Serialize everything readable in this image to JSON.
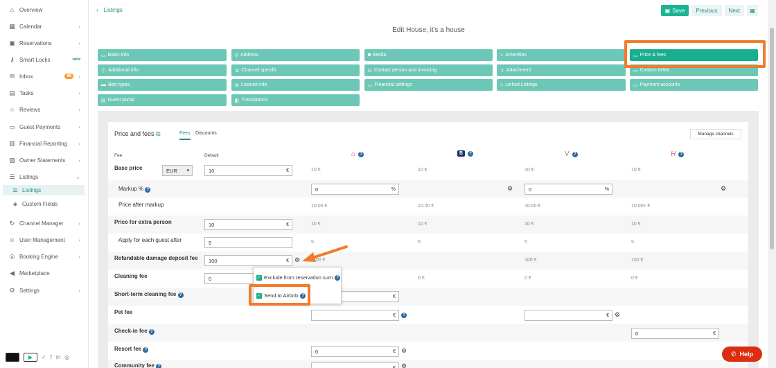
{
  "sidebar": {
    "items": [
      {
        "label": "Overview",
        "icon": "home-icon"
      },
      {
        "label": "Calendar",
        "icon": "calendar-icon"
      },
      {
        "label": "Reservations",
        "icon": "suitcase-icon"
      },
      {
        "label": "Smart Locks",
        "icon": "key-icon",
        "badge": "new"
      },
      {
        "label": "Inbox",
        "icon": "inbox-icon",
        "badge": "96"
      },
      {
        "label": "Tasks",
        "icon": "briefcase-icon"
      },
      {
        "label": "Reviews",
        "icon": "star-icon"
      },
      {
        "label": "Guest Payments",
        "icon": "card-icon"
      },
      {
        "label": "Financial Reporting",
        "icon": "report-icon"
      },
      {
        "label": "Owner Statements",
        "icon": "statement-icon"
      },
      {
        "label": "Listings",
        "icon": "list-icon"
      },
      {
        "label": "Channel Manager",
        "icon": "refresh-icon"
      },
      {
        "label": "User Management",
        "icon": "user-icon"
      },
      {
        "label": "Booking Engine",
        "icon": "globe-icon"
      },
      {
        "label": "Marketplace",
        "icon": "megaphone-icon"
      },
      {
        "label": "Settings",
        "icon": "gear-icon"
      }
    ],
    "sub": [
      {
        "label": "Listings"
      },
      {
        "label": "Custom Fields"
      }
    ]
  },
  "header": {
    "back": "Listings",
    "save": "Save",
    "previous": "Previous",
    "next": "Next",
    "title": "Edit House, it's a house"
  },
  "tabs": [
    "Basic info",
    "Address",
    "Media",
    "Amenities",
    "Price & fees",
    "Additional info",
    "Channel specific",
    "Contact person and invoicing",
    "Attachment",
    "Custom fields",
    "Bed types",
    "License info",
    "Financial settings",
    "Linked Listings",
    "Payment accounts",
    "Guest portal",
    "Translations"
  ],
  "card": {
    "title": "Price and fees",
    "subtabs": [
      "Fees",
      "Discounts"
    ],
    "manage": "Manage channels",
    "col_fee": "Fee",
    "col_default": "Default",
    "currency": "EUR"
  },
  "rows": {
    "base_price": {
      "label": "Base price",
      "default": "10",
      "v1": "10 €",
      "v2": "10 €",
      "v3": "10 €",
      "v4": "10 €"
    },
    "markup": {
      "label": "Markup %",
      "v1": "0",
      "v3": "0"
    },
    "after_markup": {
      "label": "Price after markup",
      "v1": "10.00 €",
      "v2": "10.00 €",
      "v3": "10.00 €",
      "v4": "10.00+ €"
    },
    "extra_person": {
      "label": "Price for extra person",
      "default": "10",
      "v1": "10 €",
      "v2": "10 €",
      "v3": "10 €",
      "v4": "10 €"
    },
    "each_guest": {
      "label": "Apply for each guest after",
      "default": "5",
      "v1": "5",
      "v2": "5",
      "v3": "5",
      "v4": "5"
    },
    "deposit": {
      "label": "Refundable damage deposit fee",
      "default": "100",
      "v1": "100 €",
      "v3": "100 €",
      "v4": "100 €"
    },
    "cleaning": {
      "label": "Cleaning fee",
      "default": "0",
      "v2": "0 €",
      "v3": "0 €",
      "v4": "0 €"
    },
    "short_term": {
      "label": "Short-term cleaning fee"
    },
    "pet": {
      "label": "Pet fee"
    },
    "checkin": {
      "label": "Check-in fee",
      "v4": "0"
    },
    "resort": {
      "label": "Resort fee",
      "v1": "0"
    },
    "community": {
      "label": "Community fee"
    }
  },
  "popup": {
    "exclude": "Exclude from reservation sum",
    "send": "Send to Airbnb"
  },
  "help": "Help",
  "symbols": {
    "euro": "€",
    "pct": "%"
  },
  "colors": {
    "accent": "#2c8a8a",
    "tab": "#6dc7b6",
    "tab_active": "#1aae8f",
    "highlight": "#f07c2b",
    "help": "#dc2d10"
  }
}
